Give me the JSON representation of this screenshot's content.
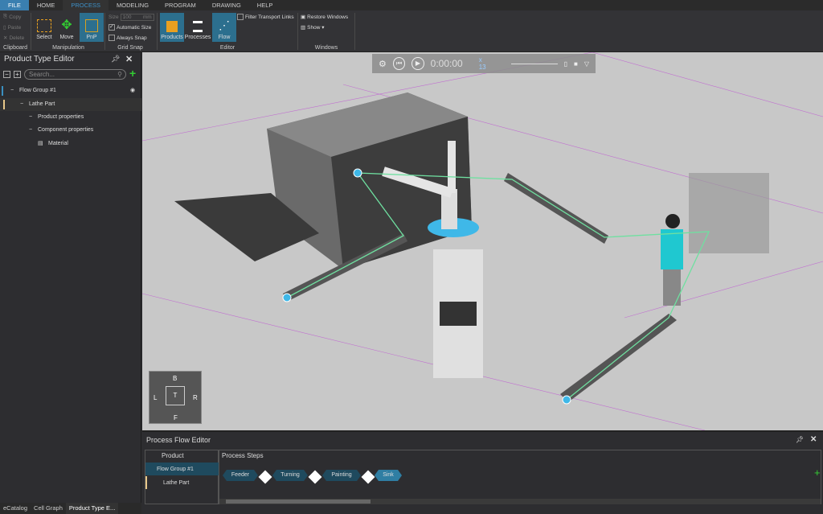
{
  "menu_tabs": [
    "FILE",
    "HOME",
    "PROCESS",
    "MODELING",
    "PROGRAM",
    "DRAWING",
    "HELP"
  ],
  "active_tab": "PROCESS",
  "ribbon": {
    "clipboard": {
      "copy": "Copy",
      "paste": "Paste",
      "delete": "Delete",
      "label": "Clipboard"
    },
    "manipulation": {
      "select": "Select",
      "move": "Move",
      "pnp": "PnP",
      "label": "Manipulation"
    },
    "grid_snap": {
      "size_label": "Size",
      "size_value": "100",
      "size_unit": "mm",
      "automatic_size": "Automatic Size",
      "automatic_size_checked": true,
      "always_snap": "Always Snap",
      "always_snap_checked": false,
      "label": "Grid Snap"
    },
    "editor": {
      "products": "Products",
      "processes": "Processes",
      "flow": "Flow",
      "filter_transport_links": "Filter Transport Links",
      "label": "Editor"
    },
    "windows": {
      "restore_windows": "Restore Windows",
      "show": "Show ▾",
      "label": "Windows"
    }
  },
  "product_type_editor": {
    "title": "Product Type Editor",
    "search_placeholder": "Search...",
    "tree": [
      {
        "label": "Flow Group #1",
        "level": 0,
        "marker": "#3a8fc0"
      },
      {
        "label": "Lathe Part",
        "level": 1,
        "marker": "#e8c88a"
      },
      {
        "label": "Product properties",
        "level": 2
      },
      {
        "label": "Component properties",
        "level": 2
      },
      {
        "label": "Material",
        "level": 3
      }
    ]
  },
  "bottom_tabs": [
    "eCatalog",
    "Cell Graph",
    "Product Type E..."
  ],
  "sim_toolbar": {
    "time": "0:00:00",
    "speed": "x 13"
  },
  "nav_cube": {
    "top": "T",
    "back": "B",
    "front": "F",
    "left": "L",
    "right": "R"
  },
  "process_flow_editor": {
    "title": "Process Flow Editor",
    "product_header": "Product",
    "steps_header": "Process Steps",
    "products": [
      "Flow Group #1",
      "Lathe Part"
    ],
    "steps": [
      "Feeder",
      "Turning",
      "Painting",
      "Sink"
    ],
    "selected_step": "Sink"
  },
  "colors": {
    "accent": "#2c6f8e",
    "flow_line": "#6fe0a0",
    "node": "#3fb8e8",
    "viewport_bg": "#c8c8c8"
  }
}
